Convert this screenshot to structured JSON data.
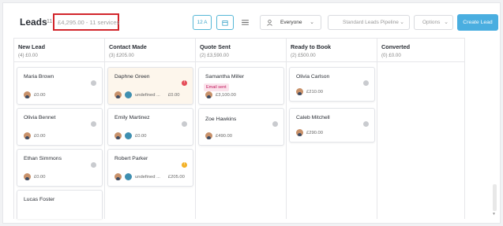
{
  "header": {
    "title": "Leads",
    "count": "11",
    "summary": "£4,295.00 - 11 services",
    "sort_label": "12 A",
    "owner_filter": "Everyone",
    "pipeline": "Standard Leads Pipeline",
    "options_label": "Options",
    "create_label": "Create Lead"
  },
  "columns": [
    {
      "name": "New Lead",
      "stat": "(4) £0.00"
    },
    {
      "name": "Contact Made",
      "stat": "(3) £205.00"
    },
    {
      "name": "Quote Sent",
      "stat": "(2) £3,590.00"
    },
    {
      "name": "Ready to Book",
      "stat": "(2) £500.00"
    },
    {
      "name": "Converted",
      "stat": "(0) £0.00"
    }
  ],
  "cards": {
    "maria": {
      "name": "Maria Brown",
      "amount": "£0.00"
    },
    "olivia_b": {
      "name": "Olivia Bennet",
      "amount": "£0.00"
    },
    "ethan": {
      "name": "Ethan Simmons",
      "amount": "£0.00"
    },
    "lucas": {
      "name": "Lucas Foster"
    },
    "daphne": {
      "name": "Daphne Green",
      "assignee": "undefined ...",
      "amount": "£0.00",
      "status_color": "#e54e5a"
    },
    "emily": {
      "name": "Emily Martinez",
      "amount": "£0.00"
    },
    "robert": {
      "name": "Robert Parker",
      "assignee": "undefined ...",
      "amount": "£205.00",
      "status_color": "#f3b229"
    },
    "samantha": {
      "name": "Samantha Miller",
      "tag": "Email sent",
      "amount": "£3,100.00"
    },
    "zoe": {
      "name": "Zoe Hawkins",
      "amount": "£490.00"
    },
    "olivia_c": {
      "name": "Olivia Carlson",
      "amount": "£210.00"
    },
    "caleb": {
      "name": "Caleb Mitchell",
      "amount": "£290.00"
    }
  }
}
